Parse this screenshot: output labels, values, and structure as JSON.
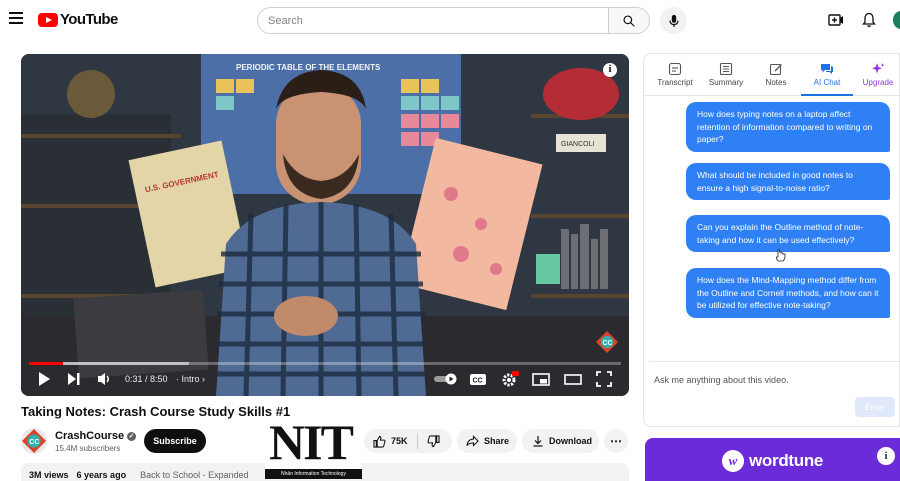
{
  "header": {
    "logo_text": "YouTube",
    "search_placeholder": "Search",
    "icons": [
      "menu-icon",
      "search-icon",
      "mic-icon",
      "create-icon",
      "bell-icon"
    ]
  },
  "player": {
    "time": "0:31 / 8:50",
    "chapter": "· Intro",
    "progress_fraction": 0.058,
    "buffer_fraction": 0.27,
    "info_glyph": "i",
    "scene_text": "PERIODIC TABLE OF THE ELEMENTS",
    "poster_text": "U.S. GOVERNMENT",
    "box_text": "GIANCOLI"
  },
  "video": {
    "title": "Taking Notes: Crash Course Study Skills #1",
    "channel_name": "CrashCourse",
    "subscribers": "15.4M subscribers",
    "subscribe_label": "Subscribe",
    "likes": "75K",
    "share_label": "Share",
    "download_label": "Download",
    "views": "3M views",
    "age": "6 years ago",
    "description_chapter": "Back to School - Expanded"
  },
  "watermark": {
    "letters": "NIT",
    "caption": "Nhân Information Technology"
  },
  "panel": {
    "tabs": [
      {
        "label": "Transcript",
        "icon": "transcript-icon"
      },
      {
        "label": "Summary",
        "icon": "summary-icon"
      },
      {
        "label": "Notes",
        "icon": "notes-icon"
      },
      {
        "label": "AI Chat",
        "icon": "chat-icon"
      },
      {
        "label": "Upgrade",
        "icon": "sparkle-icon"
      }
    ],
    "active_tab": "AI Chat",
    "messages": [
      "How does typing notes on a laptop affect retention of information compared to writing on paper?",
      "What should be included in good notes to ensure a high signal-to-noise ratio?",
      "Can you explain the Outline method of note-taking and how it can be used effectively?",
      "How does the Mind-Mapping method differ from the Outline and Cornell methods, and how can it be utilized for effective note-taking?"
    ],
    "input_placeholder": "Ask me anything about this video.",
    "enter_label": "Enter"
  },
  "ad": {
    "brand": "wordtune",
    "logo_glyph": "w",
    "info_glyph": "i"
  },
  "colors": {
    "youtube_red": "#ff0000",
    "bubble_blue": "#2f80f5",
    "active_tab": "#1a73e8",
    "upgrade_purple": "#9334e6",
    "ad_purple": "#6b2bd9"
  }
}
